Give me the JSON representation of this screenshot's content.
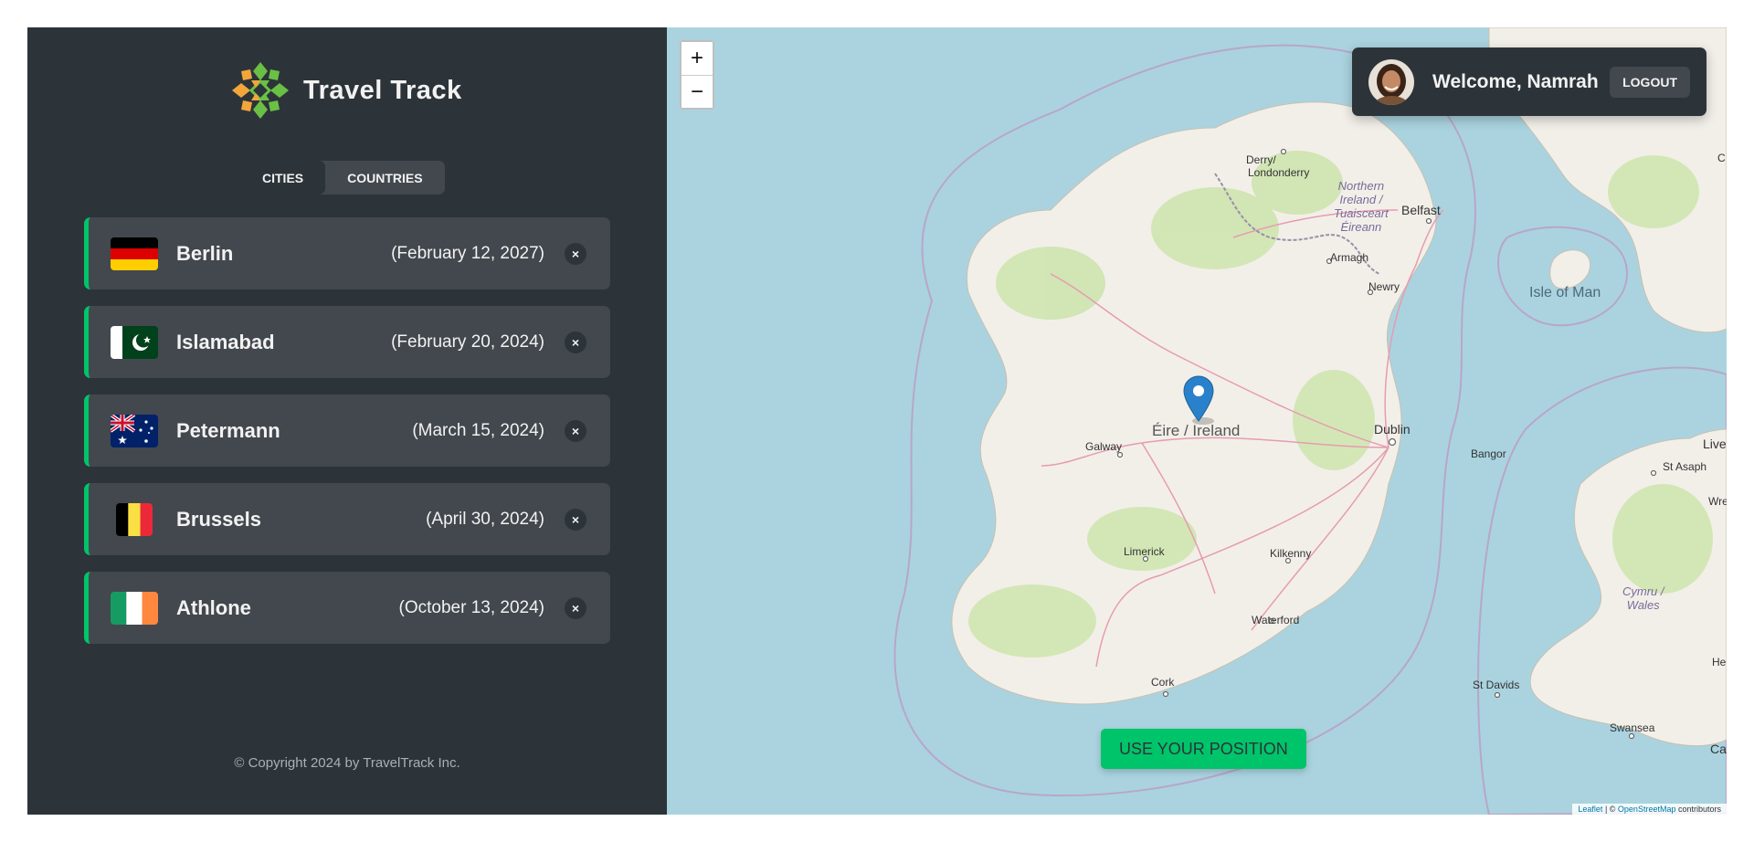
{
  "brand": {
    "name": "Travel Track",
    "colors": {
      "accent": "#00c46a",
      "dark": "#2d3439",
      "panel": "#42484e"
    }
  },
  "tabs": [
    {
      "label": "CITIES",
      "active": true
    },
    {
      "label": "COUNTRIES",
      "active": false
    }
  ],
  "cities": [
    {
      "name": "Berlin",
      "date": "(February 12, 2027)",
      "flag": "germany-flag-icon",
      "delete_label": "×"
    },
    {
      "name": "Islamabad",
      "date": "(February 20, 2024)",
      "flag": "pakistan-flag-icon",
      "delete_label": "×"
    },
    {
      "name": "Petermann",
      "date": "(March 15, 2024)",
      "flag": "australia-flag-icon",
      "delete_label": "×"
    },
    {
      "name": "Brussels",
      "date": "(April 30, 2024)",
      "flag": "belgium-flag-icon",
      "delete_label": "×"
    },
    {
      "name": "Athlone",
      "date": "(October 13, 2024)",
      "flag": "ireland-flag-icon",
      "delete_label": "×"
    }
  ],
  "footer": {
    "copyright": "© Copyright 2024 by TravelTrack Inc."
  },
  "map": {
    "zoom_in": "+",
    "zoom_out": "−",
    "user": {
      "welcome": "Welcome, Namrah",
      "logout": "LOGOUT"
    },
    "position_button": "USE YOUR POSITION",
    "labels": {
      "ireland": "Éire / Ireland",
      "derry_1": "Derry/",
      "derry_2": "Londonderry",
      "ni_1": "Northern",
      "ni_2": "Ireland /",
      "ni_3": "Tuaisceart",
      "ni_4": "Éireann",
      "belfast": "Belfast",
      "armagh": "Armagh",
      "newry": "Newry",
      "isle_of_man": "Isle of Man",
      "dublin": "Dublin",
      "galway": "Galway",
      "limerick": "Limerick",
      "kilkenny": "Kilkenny",
      "waterford": "Waterford",
      "cork": "Cork",
      "bangor": "Bangor",
      "st_asaph": "St Asaph",
      "cymru_1": "Cymru /",
      "cymru_2": "Wales",
      "st_davids": "St Davids",
      "swansea": "Swansea",
      "liv": "Live",
      "wre": "Wre",
      "he": "He",
      "card": "Cardi",
      "c": "C"
    },
    "attribution": {
      "leaflet": "Leaflet",
      "sep": " | © ",
      "osm": "OpenStreetMap",
      "suffix": " contributors"
    }
  }
}
